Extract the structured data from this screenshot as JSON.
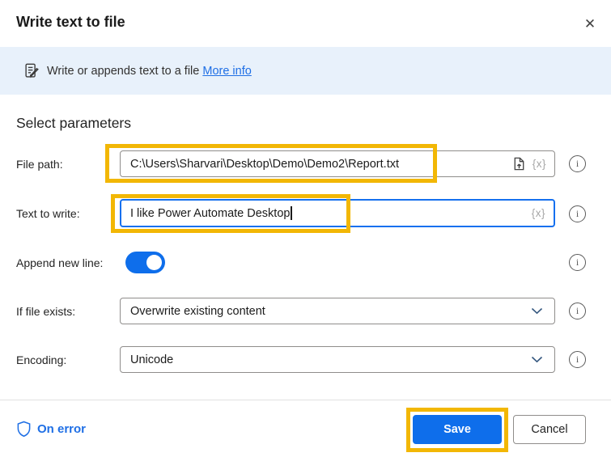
{
  "dialog": {
    "title": "Write text to file"
  },
  "banner": {
    "text": "Write or appends text to a file ",
    "link": "More info"
  },
  "parameters": {
    "heading": "Select parameters",
    "file_path": {
      "label": "File path:",
      "value": "C:\\Users\\Sharvari\\Desktop\\Demo\\Demo2\\Report.txt"
    },
    "text_to_write": {
      "label": "Text to write:",
      "value": "I like Power Automate Desktop"
    },
    "append_new_line": {
      "label": "Append new line:",
      "state": "on"
    },
    "if_file_exists": {
      "label": "If file exists:",
      "value": "Overwrite existing content"
    },
    "encoding": {
      "label": "Encoding:",
      "value": "Unicode"
    }
  },
  "glyphs": {
    "variable": "{x}",
    "info": "i",
    "close": "✕"
  },
  "footer": {
    "on_error_label": "On error",
    "save_label": "Save",
    "cancel_label": "Cancel"
  },
  "colors": {
    "accent_blue": "#0E6EEB",
    "focus_border_blue": "#1570EF",
    "highlight_yellow": "#F2B705",
    "banner_bg": "#E8F1FB",
    "link_blue": "#1F6FE5"
  }
}
